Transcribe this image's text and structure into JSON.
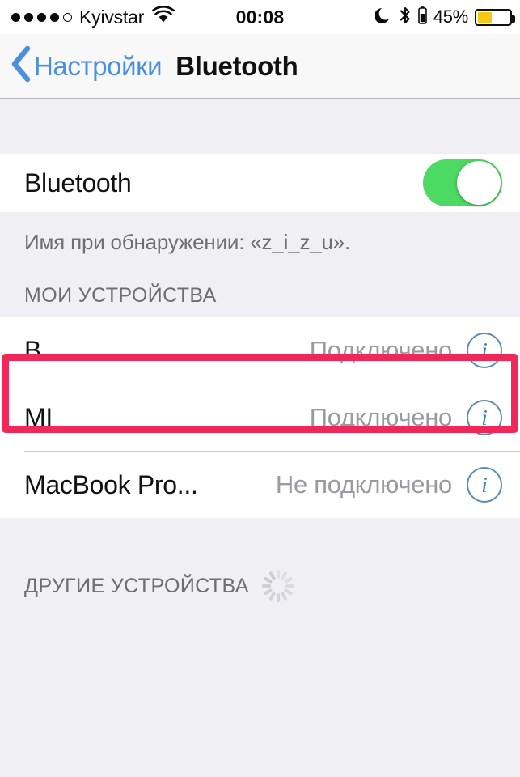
{
  "status_bar": {
    "signal_dots_filled": 4,
    "signal_dots_total": 5,
    "carrier": "Kyivstar",
    "wifi_icon": "wifi-icon",
    "time": "00:08",
    "moon_icon": "moon-do-not-disturb-icon",
    "bluetooth_icon": "bluetooth-icon",
    "battery_percent_label": "45%",
    "battery_level": 45,
    "battery_color": "#F7C818"
  },
  "nav_bar": {
    "back_icon": "chevron-left-icon",
    "back_label": "Настройки",
    "title": "Bluetooth",
    "back_color": "#4A90E2"
  },
  "bluetooth_toggle_row": {
    "label": "Bluetooth",
    "toggle_on": true,
    "toggle_on_color": "#4CD964"
  },
  "discoverable_note": "Имя при обнаружении: «z_i_z_u».",
  "my_devices": {
    "header": "МОИ УСТРОЙСТВА",
    "devices": [
      {
        "name": "B",
        "status": "Подключено",
        "info_icon": "info-icon",
        "highlighted": true
      },
      {
        "name": "MI",
        "status": "Подключено",
        "info_icon": "info-icon",
        "highlighted": false
      },
      {
        "name": "MacBook Pro...",
        "status": "Не подключено",
        "info_icon": "info-icon",
        "highlighted": false
      }
    ]
  },
  "other_devices": {
    "header": "ДРУГИЕ УСТРОЙСТВА",
    "spinner_icon": "loading-spinner-icon"
  },
  "annotation": {
    "highlight_color": "#F0285A",
    "target": "B"
  }
}
